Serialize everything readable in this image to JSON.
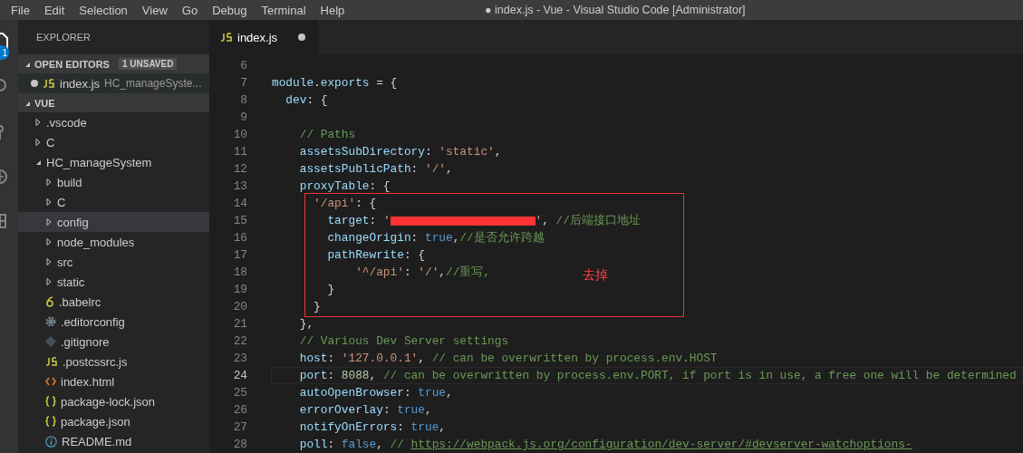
{
  "menu": [
    "File",
    "Edit",
    "Selection",
    "View",
    "Go",
    "Debug",
    "Terminal",
    "Help"
  ],
  "window": {
    "title": "● index.js - Vue - Visual Studio Code [Administrator]"
  },
  "activity_bar": {
    "badge": "1"
  },
  "sidebar": {
    "title": "EXPLORER",
    "open_editors": {
      "title": "OPEN EDITORS",
      "badge": "1 UNSAVED",
      "expanded": true,
      "items": [
        {
          "name": "index.js",
          "path": "HC_manageSyste...",
          "kind": "js",
          "unsaved": true
        }
      ]
    },
    "folder": {
      "title": "VUE",
      "expanded": true,
      "items": [
        {
          "name": ".vscode",
          "kind": "folder",
          "expanded": false,
          "selected": false
        },
        {
          "name": "C",
          "kind": "folder",
          "expanded": false,
          "selected": false
        },
        {
          "name": "HC_manageSystem",
          "kind": "folder",
          "expanded": true,
          "selected": false,
          "children": [
            {
              "name": "build",
              "kind": "folder",
              "expanded": false,
              "selected": false
            },
            {
              "name": "C",
              "kind": "folder",
              "expanded": false,
              "selected": false
            },
            {
              "name": "config",
              "kind": "folder",
              "expanded": false,
              "selected": true
            },
            {
              "name": "node_modules",
              "kind": "folder",
              "expanded": false,
              "selected": false
            },
            {
              "name": "src",
              "kind": "folder",
              "expanded": false,
              "selected": false
            },
            {
              "name": "static",
              "kind": "folder",
              "expanded": false,
              "selected": false
            },
            {
              "name": ".babelrc",
              "kind": "babel",
              "selected": false
            },
            {
              "name": ".editorconfig",
              "kind": "gear",
              "selected": false
            },
            {
              "name": ".gitignore",
              "kind": "git",
              "selected": false
            },
            {
              "name": ".postcssrc.js",
              "kind": "js",
              "selected": false
            },
            {
              "name": "index.html",
              "kind": "html",
              "selected": false
            },
            {
              "name": "package-lock.json",
              "kind": "json",
              "selected": false
            },
            {
              "name": "package.json",
              "kind": "json",
              "selected": false
            },
            {
              "name": "README.md",
              "kind": "info",
              "selected": false
            }
          ]
        }
      ]
    }
  },
  "tabs": [
    {
      "label": "index.js",
      "kind": "js",
      "selected": true,
      "unsaved": true
    }
  ],
  "editor": {
    "blocks": [
      {
        "kind": "plain",
        "lines": [
          {
            "number": "6",
            "current": false
          },
          {
            "number": "7",
            "current": false,
            "tokens": [
              {
                "kind": "key",
                "text": "module"
              },
              {
                "kind": "punct",
                "text": "."
              },
              {
                "kind": "key",
                "text": "exports"
              },
              {
                "kind": "punct",
                "text": " = {"
              }
            ]
          },
          {
            "number": "8",
            "current": false,
            "tokens": [
              {
                "kind": "key",
                "text": "  dev"
              },
              {
                "kind": "punct",
                "text": ": {"
              }
            ]
          },
          {
            "number": "9",
            "current": false
          },
          {
            "number": "10",
            "current": false,
            "tokens": [
              {
                "kind": "comment",
                "text": "    // Paths"
              }
            ]
          },
          {
            "number": "11",
            "current": false,
            "tokens": [
              {
                "kind": "key",
                "text": "    assetsSubDirectory"
              },
              {
                "kind": "punct",
                "text": ": "
              },
              {
                "kind": "string",
                "text": "'static'"
              },
              {
                "kind": "punct",
                "text": ","
              }
            ]
          },
          {
            "number": "12",
            "current": false,
            "tokens": [
              {
                "kind": "key",
                "text": "    assetsPublicPath"
              },
              {
                "kind": "punct",
                "text": ": "
              },
              {
                "kind": "string",
                "text": "'/'"
              },
              {
                "kind": "punct",
                "text": ","
              }
            ]
          },
          {
            "number": "13",
            "current": false,
            "tokens": [
              {
                "kind": "key",
                "text": "    proxyTable"
              },
              {
                "kind": "punct",
                "text": ": {"
              }
            ]
          }
        ]
      },
      {
        "kind": "annotated",
        "note": "去掉",
        "lines": [
          {
            "number": "14",
            "current": false,
            "tokens": [
              {
                "kind": "string",
                "text": "      '/api'"
              },
              {
                "kind": "punct",
                "text": ": {"
              }
            ]
          },
          {
            "number": "15",
            "current": false,
            "tokens": [
              {
                "kind": "key",
                "text": "        target"
              },
              {
                "kind": "punct",
                "text": ": "
              },
              {
                "kind": "string",
                "text": "'"
              },
              {
                "kind": "redacted"
              },
              {
                "kind": "string",
                "text": "'"
              },
              {
                "kind": "punct",
                "text": ", "
              },
              {
                "kind": "comment",
                "text": "//后端接口地址"
              }
            ]
          },
          {
            "number": "16",
            "current": false,
            "tokens": [
              {
                "kind": "key",
                "text": "        changeOrigin"
              },
              {
                "kind": "punct",
                "text": ": "
              },
              {
                "kind": "keyword",
                "text": "true"
              },
              {
                "kind": "punct",
                "text": ","
              },
              {
                "kind": "comment",
                "text": "//是否允许跨越"
              }
            ]
          },
          {
            "number": "17",
            "current": false,
            "tokens": [
              {
                "kind": "key",
                "text": "        pathRewrite"
              },
              {
                "kind": "punct",
                "text": ": {"
              }
            ]
          },
          {
            "number": "18",
            "current": false,
            "tokens": [
              {
                "kind": "string",
                "text": "            '^/api'"
              },
              {
                "kind": "punct",
                "text": ": "
              },
              {
                "kind": "string",
                "text": "'/'"
              },
              {
                "kind": "punct",
                "text": ","
              },
              {
                "kind": "comment",
                "text": "//重写,"
              }
            ]
          },
          {
            "number": "19",
            "current": false,
            "tokens": [
              {
                "kind": "punct",
                "text": "        }"
              }
            ]
          },
          {
            "number": "20",
            "current": false,
            "tokens": [
              {
                "kind": "punct",
                "text": "      }"
              }
            ]
          }
        ]
      },
      {
        "kind": "plain",
        "lines": [
          {
            "number": "21",
            "current": false,
            "tokens": [
              {
                "kind": "punct",
                "text": "    },"
              }
            ]
          },
          {
            "number": "22",
            "current": false,
            "tokens": [
              {
                "kind": "comment",
                "text": "    // Various Dev Server settings"
              }
            ]
          },
          {
            "number": "23",
            "current": false,
            "tokens": [
              {
                "kind": "key",
                "text": "    host"
              },
              {
                "kind": "punct",
                "text": ": "
              },
              {
                "kind": "string",
                "text": "'127.0.0.1'"
              },
              {
                "kind": "punct",
                "text": ", "
              },
              {
                "kind": "comment",
                "text": "// can be overwritten by process.env.HOST"
              }
            ]
          },
          {
            "number": "24",
            "current": true,
            "tokens": [
              {
                "kind": "key",
                "text": "    port"
              },
              {
                "kind": "punct",
                "text": ": "
              },
              {
                "kind": "number",
                "text": "8088"
              },
              {
                "kind": "punct",
                "text": ", "
              },
              {
                "kind": "comment",
                "text": "// can be overwritten by process.env.PORT, if port is in use, a free one will be determined"
              }
            ]
          },
          {
            "number": "25",
            "current": false,
            "tokens": [
              {
                "kind": "key",
                "text": "    autoOpenBrowser"
              },
              {
                "kind": "punct",
                "text": ": "
              },
              {
                "kind": "keyword",
                "text": "true"
              },
              {
                "kind": "punct",
                "text": ","
              }
            ]
          },
          {
            "number": "26",
            "current": false,
            "tokens": [
              {
                "kind": "key",
                "text": "    errorOverlay"
              },
              {
                "kind": "punct",
                "text": ": "
              },
              {
                "kind": "keyword",
                "text": "true"
              },
              {
                "kind": "punct",
                "text": ","
              }
            ]
          },
          {
            "number": "27",
            "current": false,
            "tokens": [
              {
                "kind": "key",
                "text": "    notifyOnErrors"
              },
              {
                "kind": "punct",
                "text": ": "
              },
              {
                "kind": "keyword",
                "text": "true"
              },
              {
                "kind": "punct",
                "text": ","
              }
            ]
          },
          {
            "number": "28",
            "current": false,
            "tokens": [
              {
                "kind": "key",
                "text": "    poll"
              },
              {
                "kind": "punct",
                "text": ": "
              },
              {
                "kind": "keyword",
                "text": "false"
              },
              {
                "kind": "punct",
                "text": ", "
              },
              {
                "kind": "comment",
                "text": "// "
              },
              {
                "kind": "link",
                "text": "https://webpack.js.org/configuration/dev-server/#devserver-watchoptions-"
              }
            ]
          }
        ]
      }
    ]
  }
}
